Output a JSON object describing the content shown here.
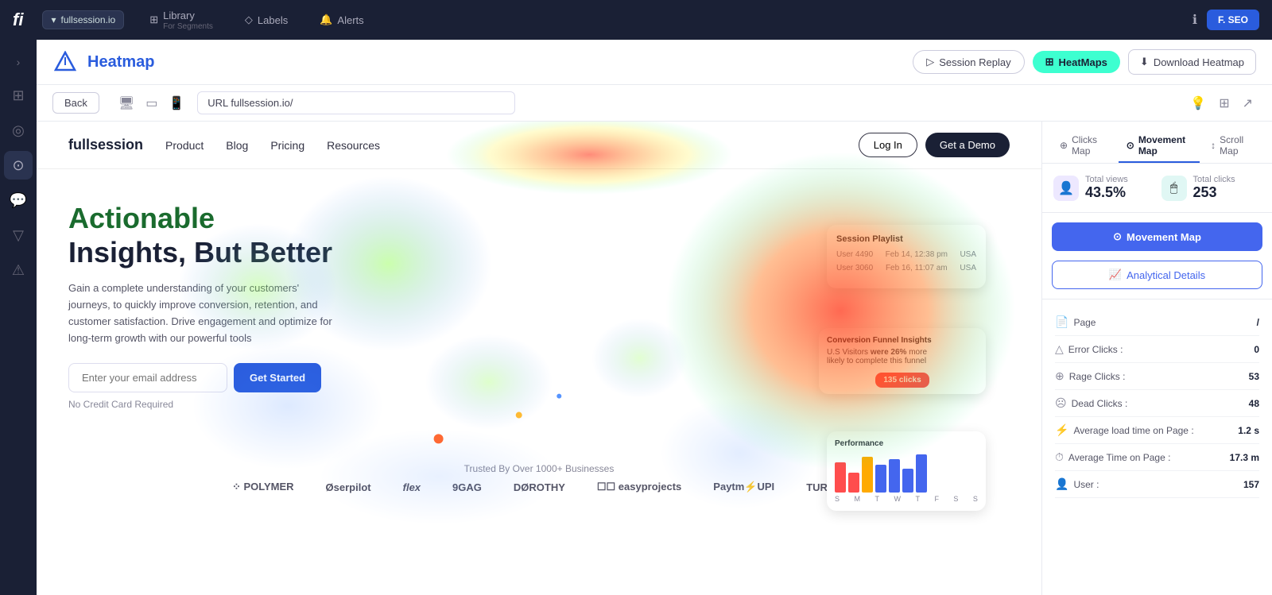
{
  "app": {
    "logo": "fi",
    "workspace": "fullsession.io"
  },
  "topnav": {
    "library_label": "Library",
    "library_sub": "For Segments",
    "labels_label": "Labels",
    "alerts_label": "Alerts",
    "user_label": "F. SEO"
  },
  "sidebar": {
    "items": [
      "grid",
      "target",
      "chat",
      "filter",
      "warning"
    ]
  },
  "header": {
    "title": "Heatmap",
    "session_replay_label": "Session Replay",
    "heatmaps_label": "HeatMaps",
    "download_label": "Download Heatmap"
  },
  "toolbar": {
    "back_label": "Back",
    "url_value": "URL fullsession.io/"
  },
  "website": {
    "logo": "fullsession",
    "nav_links": [
      "Product",
      "Blog",
      "Pricing",
      "Resources"
    ],
    "login_label": "Log In",
    "demo_label": "Get a Demo",
    "hero_h1_green": "Actionable",
    "hero_h1_dark": "Insights, But Better",
    "hero_p": "Gain a complete understanding of your customers' journeys, to quickly improve conversion, retention, and customer satisfaction. Drive engagement and optimize for long-term growth with our powerful tools",
    "email_placeholder": "Enter your email address",
    "get_started_label": "Get Started",
    "no_cc": "No Credit Card Required",
    "trusted_text": "Trusted By Over 1000+ Businesses",
    "brand_logos": [
      "POLYMER",
      "Øserpilot",
      "flex",
      "9GAG",
      "DØROTHY",
      "easyprojects",
      "Paytm⚡UPI",
      "TURION"
    ]
  },
  "right_panel": {
    "tabs": [
      {
        "label": "Clicks Map",
        "active": false
      },
      {
        "label": "Movement Map",
        "active": true
      },
      {
        "label": "Scroll Map",
        "active": false
      }
    ],
    "total_views_label": "Total views",
    "total_views_value": "43.5%",
    "total_clicks_label": "Total clicks",
    "total_clicks_value": "253",
    "movement_map_btn": "Movement Map",
    "analytical_btn": "Analytical Details",
    "analytics": [
      {
        "label": "Page",
        "value": "/"
      },
      {
        "label": "Error Clicks :",
        "value": "0"
      },
      {
        "label": "Rage Clicks :",
        "value": "53"
      },
      {
        "label": "Dead Clicks :",
        "value": "48"
      },
      {
        "label": "Average load time on Page :",
        "value": "1.2 s"
      },
      {
        "label": "Average Time on Page :",
        "value": "17.3 m"
      },
      {
        "label": "User :",
        "value": "157"
      }
    ]
  }
}
